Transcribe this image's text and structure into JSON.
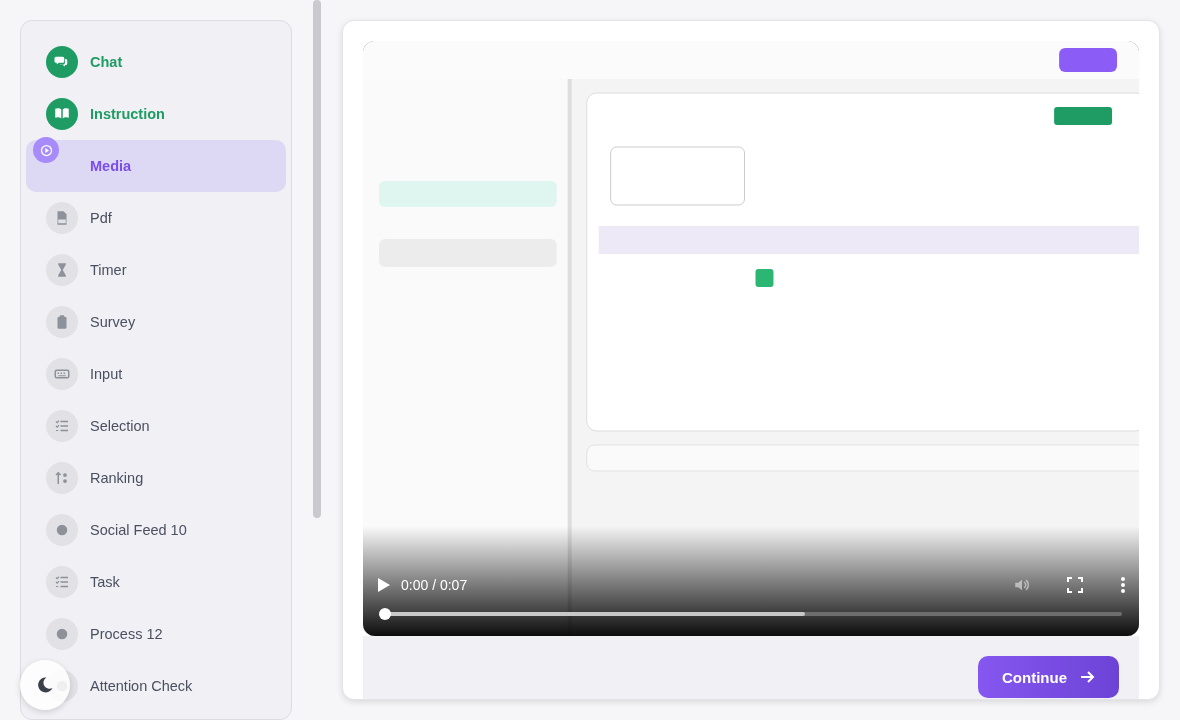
{
  "sidebar": {
    "items": [
      {
        "label": "Chat",
        "kind": "chat",
        "completed": true,
        "selected": false
      },
      {
        "label": "Instruction",
        "kind": "book",
        "completed": true,
        "selected": false
      },
      {
        "label": "Media",
        "kind": "play",
        "completed": false,
        "selected": true
      },
      {
        "label": "Pdf",
        "kind": "pdf",
        "completed": false,
        "selected": false
      },
      {
        "label": "Timer",
        "kind": "hourglass",
        "completed": false,
        "selected": false
      },
      {
        "label": "Survey",
        "kind": "clipboard",
        "completed": false,
        "selected": false
      },
      {
        "label": "Input",
        "kind": "keyboard",
        "completed": false,
        "selected": false
      },
      {
        "label": "Selection",
        "kind": "checklist",
        "completed": false,
        "selected": false
      },
      {
        "label": "Ranking",
        "kind": "sort",
        "completed": false,
        "selected": false
      },
      {
        "label": "Social Feed 10",
        "kind": "dot",
        "completed": false,
        "selected": false
      },
      {
        "label": "Task",
        "kind": "checklist",
        "completed": false,
        "selected": false
      },
      {
        "label": "Process 12",
        "kind": "dot",
        "completed": false,
        "selected": false
      },
      {
        "label": "Attention Check",
        "kind": "dot",
        "completed": false,
        "selected": false
      }
    ]
  },
  "video": {
    "time": "0:00 / 0:07",
    "playing": false,
    "progress": {
      "level": 0
    },
    "buffer": {
      "level": 0.57
    }
  },
  "continue_button": {
    "label": "Continue"
  }
}
